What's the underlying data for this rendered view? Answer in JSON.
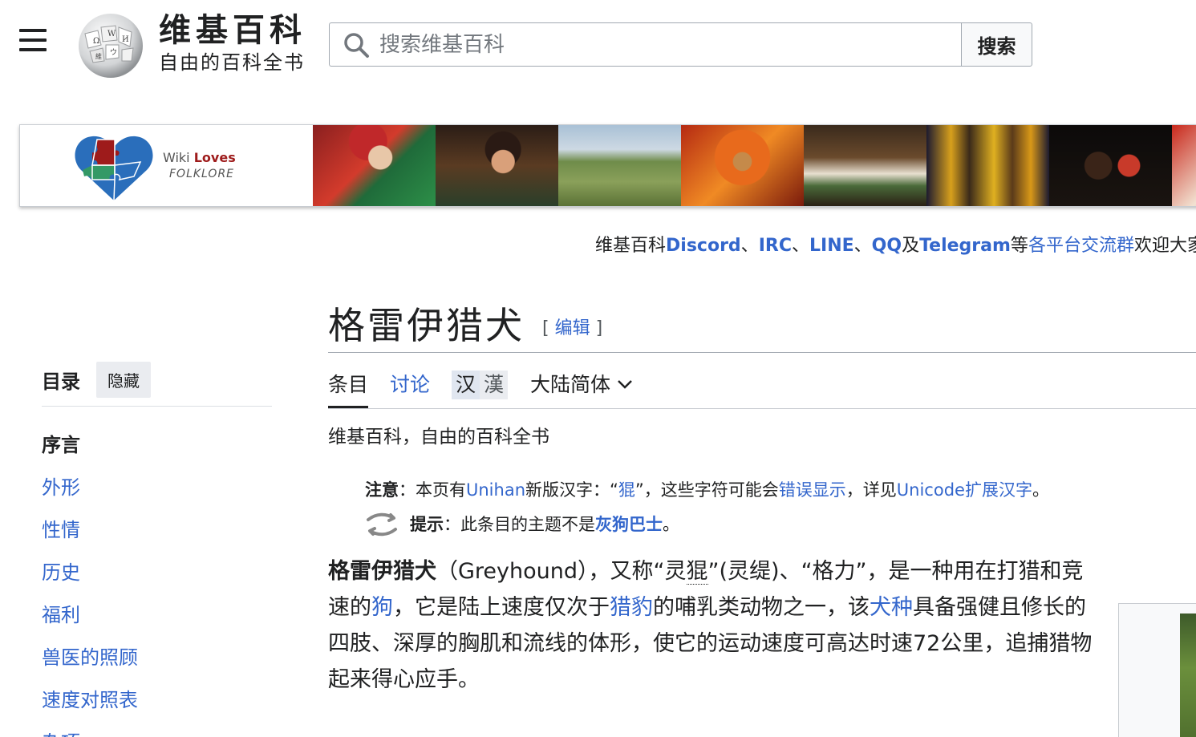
{
  "header": {
    "wordmark_title": "维基百科",
    "wordmark_tagline": "自由的百科全书",
    "search_placeholder": "搜索维基百科",
    "search_button": "搜索"
  },
  "banner": {
    "logo_word1": "Wiki",
    "logo_word2": "Loves",
    "logo_word3": "FOLKLORE"
  },
  "notice": {
    "p1": "维基百科",
    "discord": "Discord",
    "sep1": "、",
    "irc": "IRC",
    "sep2": "、",
    "line": "LINE",
    "sep3": "、",
    "qq": "QQ",
    "and": "及",
    "telegram": "Telegram",
    "etc": "等",
    "groups_link": "各平台交流群",
    "welcome": "欢迎大家加"
  },
  "article": {
    "title": "格雷伊猎犬",
    "edit_open": "[ ",
    "edit_label": "编辑",
    "edit_close": " ]",
    "tabs": {
      "article": "条目",
      "talk": "讨论",
      "han_simplified": "汉",
      "han_traditional": "漢",
      "variant": "大陆简体"
    },
    "from": "维基百科，自由的百科全书",
    "hatnote1": {
      "label": "注意",
      "t1": "：本页有",
      "unihan": "Unihan",
      "t2": "新版汉字：“",
      "char": "猑",
      "t3": "”，这些字符可能会",
      "err_link": "错误显示",
      "t4": "，详见",
      "unicode_link": "Unicode扩展汉字",
      "t5": "。"
    },
    "hatnote2": {
      "label": "提示",
      "t1": "：此条目的主题不是",
      "link": "灰狗巴士",
      "t2": "。"
    },
    "lead": {
      "bold": "格雷伊猎犬",
      "t1": "（Greyhound），又称“灵",
      "char": "猑",
      "t2": "”(灵缇)、“格力”，是一种用在打猎和竞速的",
      "dog": "狗",
      "t3": "，它是陆上速度仅次于",
      "cheetah": "猎豹",
      "t4": "的哺乳类动物之一，该",
      "breed": "犬种",
      "t5": "具备强健且修长的四肢、深厚的胸肌和流线的体形，使它的运动速度可高达时速72公里，追捕猎物起来得心应手。"
    }
  },
  "toc": {
    "heading": "目录",
    "hide": "隐藏",
    "items": [
      "序言",
      "外形",
      "性情",
      "历史",
      "福利",
      "兽医的照顾",
      "速度对照表",
      "杂项"
    ]
  },
  "colors": {
    "link": "#3366cc",
    "text": "#202122",
    "border": "#a2a9b1"
  }
}
